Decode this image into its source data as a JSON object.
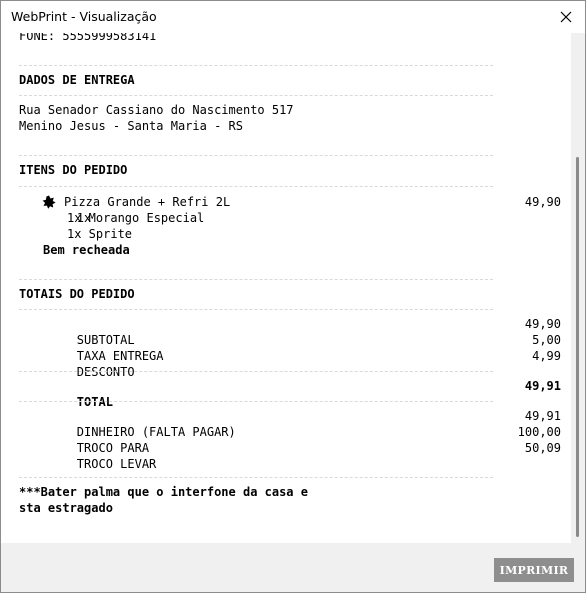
{
  "window": {
    "title": "WebPrint - Visualização",
    "close_icon": "close-icon"
  },
  "receipt": {
    "phone_line": "FONE: 5555999583141",
    "delivery": {
      "heading": "DADOS DE ENTREGA",
      "address_line1": "Rua Senador Cassiano do Nascimento 517",
      "address_line2": "Menino Jesus - Santa Maria - RS"
    },
    "items": {
      "heading": "ITENS DO PEDIDO",
      "main_qty": "1x",
      "main_icon": "star-icon",
      "main_name": "Pizza Grande + Refri 2L",
      "main_price": "49,90",
      "sub1": "1x Morango Especial",
      "sub2": "1x Sprite",
      "note": "Bem recheada"
    },
    "totals": {
      "heading": "TOTAIS DO PEDIDO",
      "subtotal_label": "SUBTOTAL",
      "subtotal_value": "49,90",
      "delivery_fee_label": "TAXA ENTREGA",
      "delivery_fee_value": "5,00",
      "discount_label": "DESCONTO",
      "discount_value": "4,99",
      "total_label": "TOTAL",
      "total_value": "49,91",
      "cash_label": "DINHEIRO (FALTA PAGAR)",
      "cash_value": "49,91",
      "change_for_label": "TROCO PARA",
      "change_for_value": "100,00",
      "change_take_label": "TROCO LEVAR",
      "change_take_value": "50,09"
    },
    "observation_line1": "***Bater palma que o interfone da casa e",
    "observation_line2": "sta estragado"
  },
  "footer": {
    "print_label": "IMPRIMIR"
  }
}
